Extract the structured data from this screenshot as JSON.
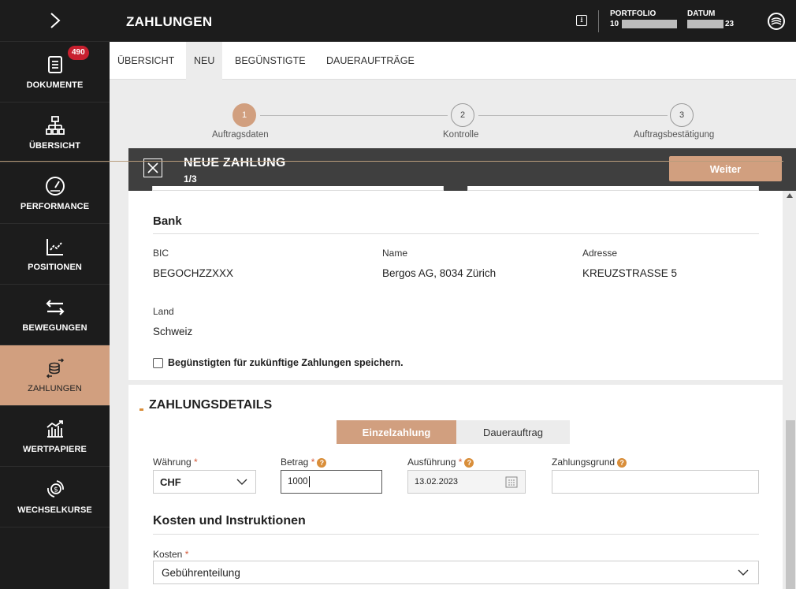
{
  "sidebar": {
    "items": [
      {
        "label": "DOKUMENTE",
        "icon": "document-icon",
        "badge": "490"
      },
      {
        "label": "ÜBERSICHT",
        "icon": "sitemap-icon"
      },
      {
        "label": "PERFORMANCE",
        "icon": "gauge-icon"
      },
      {
        "label": "POSITIONEN",
        "icon": "line-chart-icon"
      },
      {
        "label": "BEWEGUNGEN",
        "icon": "transfer-arrows-icon"
      },
      {
        "label": "ZAHLUNGEN",
        "icon": "payment-icon",
        "active": true
      },
      {
        "label": "WERTPAPIERE",
        "icon": "securities-icon"
      },
      {
        "label": "WECHSELKURSE",
        "icon": "exchange-icon"
      }
    ]
  },
  "header": {
    "title": "ZAHLUNGEN",
    "portfolio_label": "PORTFOLIO",
    "portfolio_value": "10",
    "date_label": "DATUM",
    "date_value": "23"
  },
  "tabs": [
    "ÜBERSICHT",
    "NEU",
    "BEGÜNSTIGTE",
    "DAUERAUFTRÄGE"
  ],
  "active_tab": "NEU",
  "stepper": [
    {
      "num": "1",
      "label": "Auftragsdaten"
    },
    {
      "num": "2",
      "label": "Kontrolle"
    },
    {
      "num": "3",
      "label": "Auftragsbestätigung"
    }
  ],
  "actionbar": {
    "title": "NEUE ZAHLUNG",
    "step": "1/3",
    "next_label": "Weiter"
  },
  "bank": {
    "title": "Bank",
    "bic_label": "BIC",
    "bic_value": "BEGOCHZZXXX",
    "name_label": "Name",
    "name_value": "Bergos AG, 8034 Zürich",
    "address_label": "Adresse",
    "address_value": "KREUZSTRASSE 5",
    "country_label": "Land",
    "country_value": "Schweiz",
    "save_checkbox_label": "Begünstigten für zukünftige Zahlungen speichern."
  },
  "details": {
    "title": "ZAHLUNGSDETAILS",
    "seg_single": "Einzelzahlung",
    "seg_standing": "Dauerauftrag",
    "currency_label": "Währung",
    "currency_value": "CHF",
    "amount_label": "Betrag",
    "amount_value": "1000",
    "execution_label": "Ausführung",
    "execution_value": "13.02.2023",
    "reason_label": "Zahlungsgrund",
    "reason_value": ""
  },
  "costs": {
    "title": "Kosten und Instruktionen",
    "costs_label": "Kosten",
    "costs_value": "Gebührenteilung"
  },
  "colors": {
    "accent": "#d19f7f",
    "dark": "#1c1c1c",
    "bar": "#3f3f3f"
  }
}
